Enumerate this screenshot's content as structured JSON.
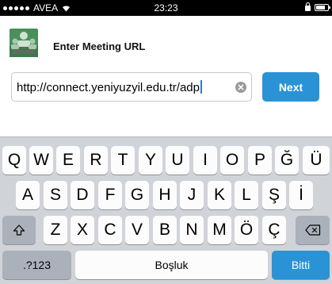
{
  "status_bar": {
    "carrier": "AVEA",
    "wifi_icon": "wifi-icon",
    "time": "23:23",
    "lock_icon": "lock-icon",
    "battery_icon": "battery-icon"
  },
  "header": {
    "logo_icon": "meeting-app-logo-icon",
    "title": "Enter Meeting URL"
  },
  "url_input": {
    "value": "http://connect.yeniyuzyil.edu.tr/adp",
    "clear_icon": "clear-icon"
  },
  "next_button": {
    "label": "Next"
  },
  "keyboard": {
    "row1": [
      "Q",
      "W",
      "E",
      "R",
      "T",
      "Y",
      "U",
      "I",
      "O",
      "P",
      "Ğ",
      "Ü"
    ],
    "row2": [
      "A",
      "S",
      "D",
      "F",
      "G",
      "H",
      "J",
      "K",
      "L",
      "Ş",
      "İ"
    ],
    "row3": [
      "Z",
      "X",
      "C",
      "V",
      "B",
      "N",
      "M",
      "Ö",
      "Ç"
    ],
    "shift_icon": "shift-icon",
    "backspace_icon": "backspace-icon",
    "numbers_label": ".?123",
    "space_label": "Boşluk",
    "done_label": "Bitti"
  },
  "colors": {
    "accent_blue": "#2a93d5",
    "keyboard_background": "#d0d3d8",
    "key_background": "#fcfcfc",
    "special_key_background": "#abb1ba",
    "status_bar_background": "#000000"
  }
}
